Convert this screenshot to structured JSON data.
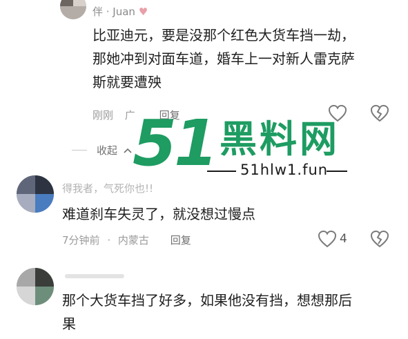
{
  "comments": [
    {
      "username": "伴 · Juan",
      "text_lines": [
        "比亚迪元，要是没那个红色大货车挡一劫，",
        "那她冲到对面车道，婚车上一对新人雷克萨",
        "斯就要遭殃"
      ],
      "time": "刚刚",
      "location": "广",
      "reply_label": "回复",
      "collapse_label": "收起"
    },
    {
      "username": "得我者，气死你也!!",
      "text_lines": [
        "难道刹车失灵了，就没想过慢点"
      ],
      "time": "7分钟前",
      "separator": "·",
      "location": "内蒙古",
      "reply_label": "回复",
      "like_count": "4"
    },
    {
      "text_lines": [
        "那个大货车挡了好多，如果他没有挡，想想那后",
        "果"
      ]
    }
  ],
  "watermark": {
    "number": "51",
    "chinese": "黑料网",
    "url": "51hlw1.fun"
  },
  "colors": {
    "watermark_green": "#1e9c62",
    "text": "#1f1f1f",
    "meta": "#9b9b9b",
    "icon": "#7a7a7a"
  }
}
